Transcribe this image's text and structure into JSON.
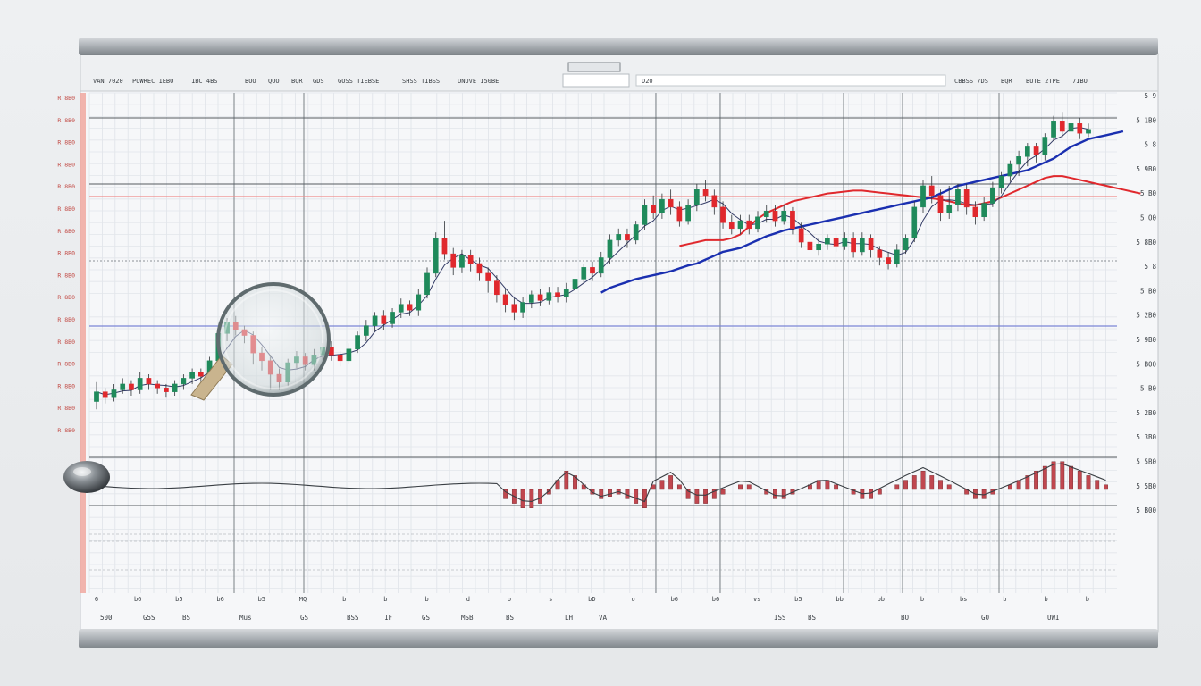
{
  "chart_data": {
    "type": "candlestick",
    "grid": true,
    "colors": {
      "up": "#1f8a5b",
      "down": "#e0282d",
      "ma_blue": "#1a2fb0",
      "ma_red": "#e0282d",
      "ma_thin": "#333b66",
      "oscillator_fill": "#c0474f",
      "hline_red": "#f08c8c",
      "hline_blue": "#7b86d6",
      "panel": "#f6f7f9",
      "frame": "#9aa0a6"
    },
    "header_texts": [
      "VAN 7020",
      "PUWREC 1EBO",
      "1BC 4BS",
      "BOO",
      "QOO",
      "BQR",
      "GDS",
      "GOSS TIEBSE",
      "SHSS TIBSS",
      "UNUVE 150BE",
      "D20",
      "CBBSS 7DS",
      "BQR",
      "BUTE 2TPE",
      "7IBO"
    ],
    "left_axis_labels": [
      "R 8B0",
      "R 8B0",
      "R 8B0",
      "R 8B0",
      "R 8B0",
      "R 8B0",
      "R 8B0",
      "R 8B0",
      "R 8B0",
      "R 8B0",
      "R 8B0",
      "R 8B0",
      "R 8B0",
      "R 8B0",
      "R 8B0",
      "R 8B0"
    ],
    "right_axis_labels": [
      "5 9",
      "5 1B0",
      "5 8",
      "5 9B0",
      "5 B0",
      "5 O0",
      "5 8B0",
      "5 8",
      "5 B0",
      "5 2B0",
      "5 9B0",
      "5 B00",
      "5 B0",
      "5 2B0",
      "5 3B0",
      "5 5B0",
      "5 5B0",
      "5 B00"
    ],
    "x_tick_labels": [
      "6",
      "b6",
      "b5",
      "b6",
      "b5",
      "MQ",
      "b",
      "b",
      "b",
      "d",
      "o",
      "s",
      "bD",
      "o",
      "b6",
      "b6",
      "vs",
      "b5",
      "bb",
      "bb",
      "b",
      "bs",
      "b",
      "b",
      "b"
    ],
    "footer_texts": [
      "500",
      "G5S",
      "BS",
      "Mus",
      "GS",
      "BSS",
      "1F",
      "GS",
      "MSB",
      "BS",
      "LH",
      "VA",
      "ISS",
      "BS",
      "BO",
      "GO",
      "UWI"
    ],
    "candles": [
      {
        "o": 428,
        "c": 438,
        "h": 448,
        "l": 420
      },
      {
        "o": 438,
        "c": 432,
        "h": 442,
        "l": 426
      },
      {
        "o": 432,
        "c": 440,
        "h": 446,
        "l": 428
      },
      {
        "o": 440,
        "c": 446,
        "h": 452,
        "l": 436
      },
      {
        "o": 446,
        "c": 440,
        "h": 450,
        "l": 434
      },
      {
        "o": 440,
        "c": 452,
        "h": 458,
        "l": 436
      },
      {
        "o": 452,
        "c": 446,
        "h": 456,
        "l": 440
      },
      {
        "o": 446,
        "c": 442,
        "h": 450,
        "l": 436
      },
      {
        "o": 442,
        "c": 438,
        "h": 446,
        "l": 432
      },
      {
        "o": 438,
        "c": 446,
        "h": 450,
        "l": 434
      },
      {
        "o": 446,
        "c": 452,
        "h": 456,
        "l": 440
      },
      {
        "o": 452,
        "c": 458,
        "h": 462,
        "l": 446
      },
      {
        "o": 458,
        "c": 454,
        "h": 462,
        "l": 448
      },
      {
        "o": 454,
        "c": 470,
        "h": 474,
        "l": 450
      },
      {
        "o": 470,
        "c": 498,
        "h": 504,
        "l": 466
      },
      {
        "o": 498,
        "c": 510,
        "h": 514,
        "l": 490
      },
      {
        "o": 510,
        "c": 502,
        "h": 516,
        "l": 496
      },
      {
        "o": 502,
        "c": 496,
        "h": 506,
        "l": 488
      },
      {
        "o": 496,
        "c": 478,
        "h": 500,
        "l": 466
      },
      {
        "o": 478,
        "c": 470,
        "h": 484,
        "l": 460
      },
      {
        "o": 470,
        "c": 456,
        "h": 476,
        "l": 440
      },
      {
        "o": 456,
        "c": 448,
        "h": 462,
        "l": 440
      },
      {
        "o": 448,
        "c": 468,
        "h": 472,
        "l": 444
      },
      {
        "o": 468,
        "c": 474,
        "h": 480,
        "l": 462
      },
      {
        "o": 474,
        "c": 466,
        "h": 478,
        "l": 460
      },
      {
        "o": 466,
        "c": 476,
        "h": 482,
        "l": 460
      },
      {
        "o": 476,
        "c": 484,
        "h": 488,
        "l": 470
      },
      {
        "o": 484,
        "c": 476,
        "h": 490,
        "l": 470
      },
      {
        "o": 476,
        "c": 470,
        "h": 480,
        "l": 464
      },
      {
        "o": 470,
        "c": 482,
        "h": 488,
        "l": 466
      },
      {
        "o": 482,
        "c": 496,
        "h": 500,
        "l": 478
      },
      {
        "o": 496,
        "c": 506,
        "h": 512,
        "l": 490
      },
      {
        "o": 506,
        "c": 516,
        "h": 520,
        "l": 500
      },
      {
        "o": 516,
        "c": 508,
        "h": 522,
        "l": 502
      },
      {
        "o": 508,
        "c": 520,
        "h": 524,
        "l": 504
      },
      {
        "o": 520,
        "c": 528,
        "h": 534,
        "l": 514
      },
      {
        "o": 528,
        "c": 522,
        "h": 532,
        "l": 516
      },
      {
        "o": 522,
        "c": 538,
        "h": 544,
        "l": 516
      },
      {
        "o": 538,
        "c": 560,
        "h": 566,
        "l": 534
      },
      {
        "o": 560,
        "c": 596,
        "h": 602,
        "l": 556
      },
      {
        "o": 596,
        "c": 580,
        "h": 614,
        "l": 574
      },
      {
        "o": 580,
        "c": 566,
        "h": 586,
        "l": 558
      },
      {
        "o": 566,
        "c": 578,
        "h": 584,
        "l": 560
      },
      {
        "o": 578,
        "c": 570,
        "h": 584,
        "l": 562
      },
      {
        "o": 570,
        "c": 560,
        "h": 576,
        "l": 552
      },
      {
        "o": 560,
        "c": 552,
        "h": 566,
        "l": 540
      },
      {
        "o": 552,
        "c": 538,
        "h": 558,
        "l": 530
      },
      {
        "o": 538,
        "c": 528,
        "h": 544,
        "l": 520
      },
      {
        "o": 528,
        "c": 520,
        "h": 534,
        "l": 512
      },
      {
        "o": 520,
        "c": 530,
        "h": 536,
        "l": 514
      },
      {
        "o": 530,
        "c": 538,
        "h": 542,
        "l": 524
      },
      {
        "o": 538,
        "c": 532,
        "h": 544,
        "l": 526
      },
      {
        "o": 532,
        "c": 540,
        "h": 546,
        "l": 528
      },
      {
        "o": 540,
        "c": 536,
        "h": 546,
        "l": 530
      },
      {
        "o": 536,
        "c": 544,
        "h": 550,
        "l": 530
      },
      {
        "o": 544,
        "c": 554,
        "h": 558,
        "l": 540
      },
      {
        "o": 554,
        "c": 566,
        "h": 570,
        "l": 550
      },
      {
        "o": 566,
        "c": 560,
        "h": 572,
        "l": 552
      },
      {
        "o": 560,
        "c": 576,
        "h": 582,
        "l": 556
      },
      {
        "o": 576,
        "c": 594,
        "h": 600,
        "l": 570
      },
      {
        "o": 594,
        "c": 600,
        "h": 606,
        "l": 588
      },
      {
        "o": 600,
        "c": 594,
        "h": 606,
        "l": 586
      },
      {
        "o": 594,
        "c": 610,
        "h": 614,
        "l": 590
      },
      {
        "o": 610,
        "c": 630,
        "h": 636,
        "l": 604
      },
      {
        "o": 630,
        "c": 622,
        "h": 640,
        "l": 616
      },
      {
        "o": 622,
        "c": 636,
        "h": 642,
        "l": 616
      },
      {
        "o": 636,
        "c": 628,
        "h": 646,
        "l": 620
      },
      {
        "o": 628,
        "c": 614,
        "h": 634,
        "l": 608
      },
      {
        "o": 614,
        "c": 630,
        "h": 636,
        "l": 610
      },
      {
        "o": 630,
        "c": 646,
        "h": 652,
        "l": 624
      },
      {
        "o": 646,
        "c": 640,
        "h": 656,
        "l": 634
      },
      {
        "o": 640,
        "c": 628,
        "h": 646,
        "l": 620
      },
      {
        "o": 628,
        "c": 612,
        "h": 634,
        "l": 606
      },
      {
        "o": 612,
        "c": 606,
        "h": 620,
        "l": 600
      },
      {
        "o": 606,
        "c": 614,
        "h": 620,
        "l": 600
      },
      {
        "o": 614,
        "c": 606,
        "h": 620,
        "l": 600
      },
      {
        "o": 606,
        "c": 618,
        "h": 624,
        "l": 602
      },
      {
        "o": 618,
        "c": 624,
        "h": 630,
        "l": 612
      },
      {
        "o": 624,
        "c": 614,
        "h": 630,
        "l": 608
      },
      {
        "o": 614,
        "c": 624,
        "h": 630,
        "l": 610
      },
      {
        "o": 624,
        "c": 606,
        "h": 628,
        "l": 600
      },
      {
        "o": 606,
        "c": 592,
        "h": 612,
        "l": 586
      },
      {
        "o": 592,
        "c": 584,
        "h": 598,
        "l": 576
      },
      {
        "o": 584,
        "c": 590,
        "h": 596,
        "l": 578
      },
      {
        "o": 590,
        "c": 596,
        "h": 600,
        "l": 584
      },
      {
        "o": 596,
        "c": 588,
        "h": 600,
        "l": 582
      },
      {
        "o": 588,
        "c": 596,
        "h": 602,
        "l": 584
      },
      {
        "o": 596,
        "c": 582,
        "h": 602,
        "l": 576
      },
      {
        "o": 582,
        "c": 596,
        "h": 602,
        "l": 578
      },
      {
        "o": 596,
        "c": 584,
        "h": 600,
        "l": 576
      },
      {
        "o": 584,
        "c": 576,
        "h": 588,
        "l": 568
      },
      {
        "o": 576,
        "c": 570,
        "h": 582,
        "l": 564
      },
      {
        "o": 570,
        "c": 584,
        "h": 590,
        "l": 566
      },
      {
        "o": 584,
        "c": 596,
        "h": 600,
        "l": 580
      },
      {
        "o": 596,
        "c": 628,
        "h": 634,
        "l": 592
      },
      {
        "o": 628,
        "c": 650,
        "h": 656,
        "l": 622
      },
      {
        "o": 650,
        "c": 640,
        "h": 660,
        "l": 632
      },
      {
        "o": 640,
        "c": 622,
        "h": 646,
        "l": 614
      },
      {
        "o": 622,
        "c": 630,
        "h": 650,
        "l": 616
      },
      {
        "o": 630,
        "c": 646,
        "h": 652,
        "l": 624
      },
      {
        "o": 646,
        "c": 628,
        "h": 652,
        "l": 620
      },
      {
        "o": 628,
        "c": 618,
        "h": 634,
        "l": 610
      },
      {
        "o": 618,
        "c": 632,
        "h": 638,
        "l": 614
      },
      {
        "o": 632,
        "c": 648,
        "h": 654,
        "l": 628
      },
      {
        "o": 648,
        "c": 660,
        "h": 664,
        "l": 642
      },
      {
        "o": 660,
        "c": 672,
        "h": 676,
        "l": 654
      },
      {
        "o": 672,
        "c": 680,
        "h": 686,
        "l": 660
      },
      {
        "o": 680,
        "c": 690,
        "h": 694,
        "l": 670
      },
      {
        "o": 690,
        "c": 682,
        "h": 694,
        "l": 674
      },
      {
        "o": 682,
        "c": 700,
        "h": 704,
        "l": 676
      },
      {
        "o": 700,
        "c": 716,
        "h": 722,
        "l": 696
      },
      {
        "o": 716,
        "c": 706,
        "h": 726,
        "l": 700
      },
      {
        "o": 706,
        "c": 714,
        "h": 724,
        "l": 702
      },
      {
        "o": 714,
        "c": 704,
        "h": 720,
        "l": 698
      },
      {
        "o": 704,
        "c": 708,
        "h": 714,
        "l": 700
      }
    ],
    "ma_blue": [
      null,
      null,
      null,
      null,
      null,
      null,
      null,
      null,
      null,
      null,
      null,
      null,
      null,
      null,
      null,
      null,
      null,
      null,
      null,
      null,
      null,
      null,
      null,
      null,
      null,
      null,
      null,
      null,
      null,
      null,
      null,
      null,
      null,
      null,
      null,
      null,
      null,
      null,
      null,
      null,
      null,
      null,
      null,
      null,
      null,
      null,
      null,
      null,
      null,
      null,
      null,
      null,
      null,
      null,
      null,
      null,
      null,
      null,
      540,
      545,
      548,
      551,
      554,
      556,
      558,
      560,
      562,
      565,
      568,
      570,
      574,
      578,
      582,
      584,
      586,
      590,
      594,
      598,
      601,
      604,
      606,
      608,
      610,
      612,
      614,
      616,
      618,
      620,
      622,
      624,
      626,
      628,
      630,
      632,
      634,
      636,
      638,
      642,
      646,
      650,
      652,
      654,
      656,
      658,
      660,
      662,
      664,
      666,
      670,
      674,
      678,
      684,
      690,
      694,
      698,
      700,
      702,
      704,
      706
    ],
    "ma_red": [
      null,
      null,
      null,
      null,
      null,
      null,
      null,
      null,
      null,
      null,
      null,
      null,
      null,
      null,
      null,
      null,
      null,
      null,
      null,
      null,
      null,
      null,
      null,
      null,
      null,
      null,
      null,
      null,
      null,
      null,
      null,
      null,
      null,
      null,
      null,
      null,
      null,
      null,
      null,
      null,
      null,
      null,
      null,
      null,
      null,
      null,
      null,
      null,
      null,
      null,
      null,
      null,
      null,
      null,
      null,
      null,
      null,
      null,
      null,
      null,
      null,
      null,
      null,
      null,
      null,
      null,
      null,
      588,
      590,
      592,
      594,
      594,
      594,
      596,
      600,
      608,
      616,
      622,
      626,
      630,
      634,
      636,
      638,
      640,
      642,
      643,
      644,
      645,
      645,
      644,
      643,
      642,
      641,
      640,
      639,
      638,
      637,
      636,
      634,
      632,
      630,
      630,
      632,
      634,
      638,
      642,
      646,
      650,
      654,
      658,
      660,
      660,
      658,
      656,
      654,
      652,
      650,
      648,
      646,
      644,
      642
    ],
    "oscillator": [
      0,
      0,
      0,
      0,
      0,
      0,
      0,
      0,
      0,
      0,
      0,
      0,
      0,
      0,
      0,
      0,
      0,
      0,
      0,
      0,
      0,
      0,
      0,
      0,
      0,
      0,
      0,
      0,
      0,
      0,
      0,
      0,
      0,
      0,
      0,
      0,
      0,
      0,
      0,
      0,
      0,
      0,
      0,
      0,
      0,
      0,
      0,
      -4,
      -6,
      -8,
      -8,
      -6,
      -2,
      4,
      8,
      6,
      2,
      -2,
      -4,
      -3,
      -2,
      -4,
      -6,
      -8,
      2,
      4,
      6,
      2,
      -4,
      -6,
      -6,
      -4,
      -2,
      0,
      2,
      2,
      0,
      -2,
      -4,
      -4,
      -2,
      0,
      2,
      4,
      4,
      2,
      0,
      -2,
      -4,
      -4,
      -2,
      0,
      2,
      4,
      6,
      8,
      6,
      4,
      2,
      0,
      -2,
      -4,
      -4,
      -2,
      0,
      2,
      4,
      6,
      8,
      10,
      12,
      12,
      10,
      8,
      6,
      4,
      2
    ],
    "y_range": [
      400,
      740
    ]
  }
}
